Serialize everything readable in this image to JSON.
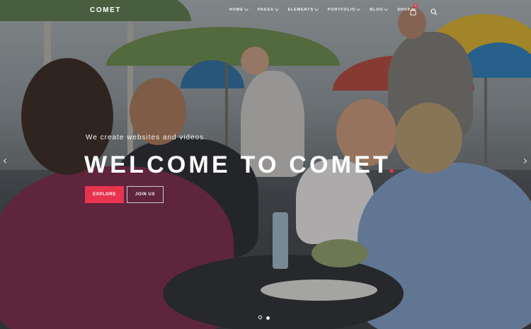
{
  "brand": {
    "logo": "COMET",
    "accent": "#e8344f"
  },
  "nav": {
    "items": [
      {
        "label": "HOME"
      },
      {
        "label": "PAGES"
      },
      {
        "label": "ELEMENTS"
      },
      {
        "label": "PORTFOLIO"
      },
      {
        "label": "BLOG"
      },
      {
        "label": "SHOP"
      }
    ],
    "cart_count": "0",
    "icons": {
      "cart": "shopping-bag-icon",
      "search": "search-icon"
    }
  },
  "hero": {
    "tagline": "We create websites and videos.",
    "title": "WELCOME TO COMET",
    "title_dot": ".",
    "buttons": {
      "explore": "EXPLORE",
      "join": "JOIN US"
    }
  },
  "slider": {
    "slides": 2,
    "active": 2
  }
}
